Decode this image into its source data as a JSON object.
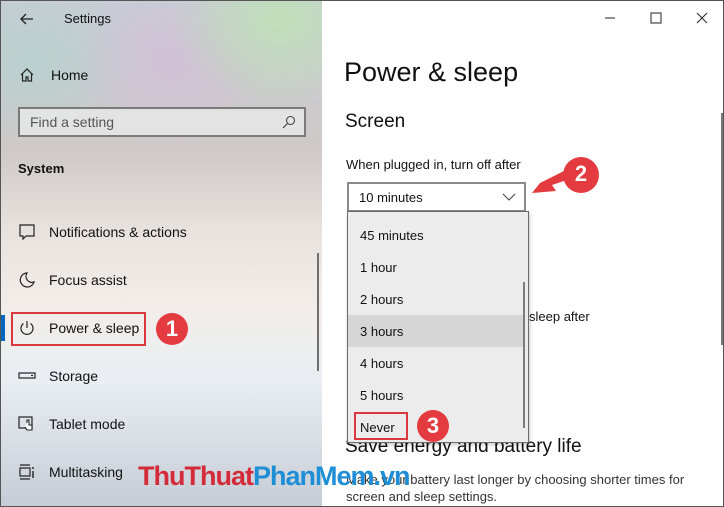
{
  "window": {
    "app_title": "Settings",
    "controls": {
      "minimize": "minimize",
      "maximize": "maximize",
      "close": "close"
    }
  },
  "sidebar": {
    "home_label": "Home",
    "search": {
      "placeholder": "Find a setting",
      "value": ""
    },
    "section_label": "System",
    "items": [
      {
        "label": "Notifications & actions",
        "icon": "notifications-icon"
      },
      {
        "label": "Focus assist",
        "icon": "moon-icon"
      },
      {
        "label": "Power & sleep",
        "icon": "power-icon",
        "active": true
      },
      {
        "label": "Storage",
        "icon": "storage-icon"
      },
      {
        "label": "Tablet mode",
        "icon": "tablet-mode-icon"
      },
      {
        "label": "Multitasking",
        "icon": "multitasking-icon"
      }
    ]
  },
  "main": {
    "page_title": "Power & sleep",
    "screen_section": "Screen",
    "plugged_in_label": "When plugged in, turn off after",
    "plugged_in_value": "10 minutes",
    "sleep_label_fragment": "sleep after",
    "dropdown_options": [
      "45 minutes",
      "1 hour",
      "2 hours",
      "3 hours",
      "4 hours",
      "5 hours",
      "Never"
    ],
    "hovered_option": "3 hours",
    "save_energy_title": "Save energy and battery life",
    "save_energy_desc": "Make your battery last longer by choosing shorter times for screen and sleep settings."
  },
  "annotations": {
    "step1": "1",
    "step2": "2",
    "step3": "3",
    "accent_color": "#e33b3f"
  },
  "watermark": {
    "part1": "ThuThuat",
    "part2": "PhanMem",
    "part3": ".vn"
  }
}
